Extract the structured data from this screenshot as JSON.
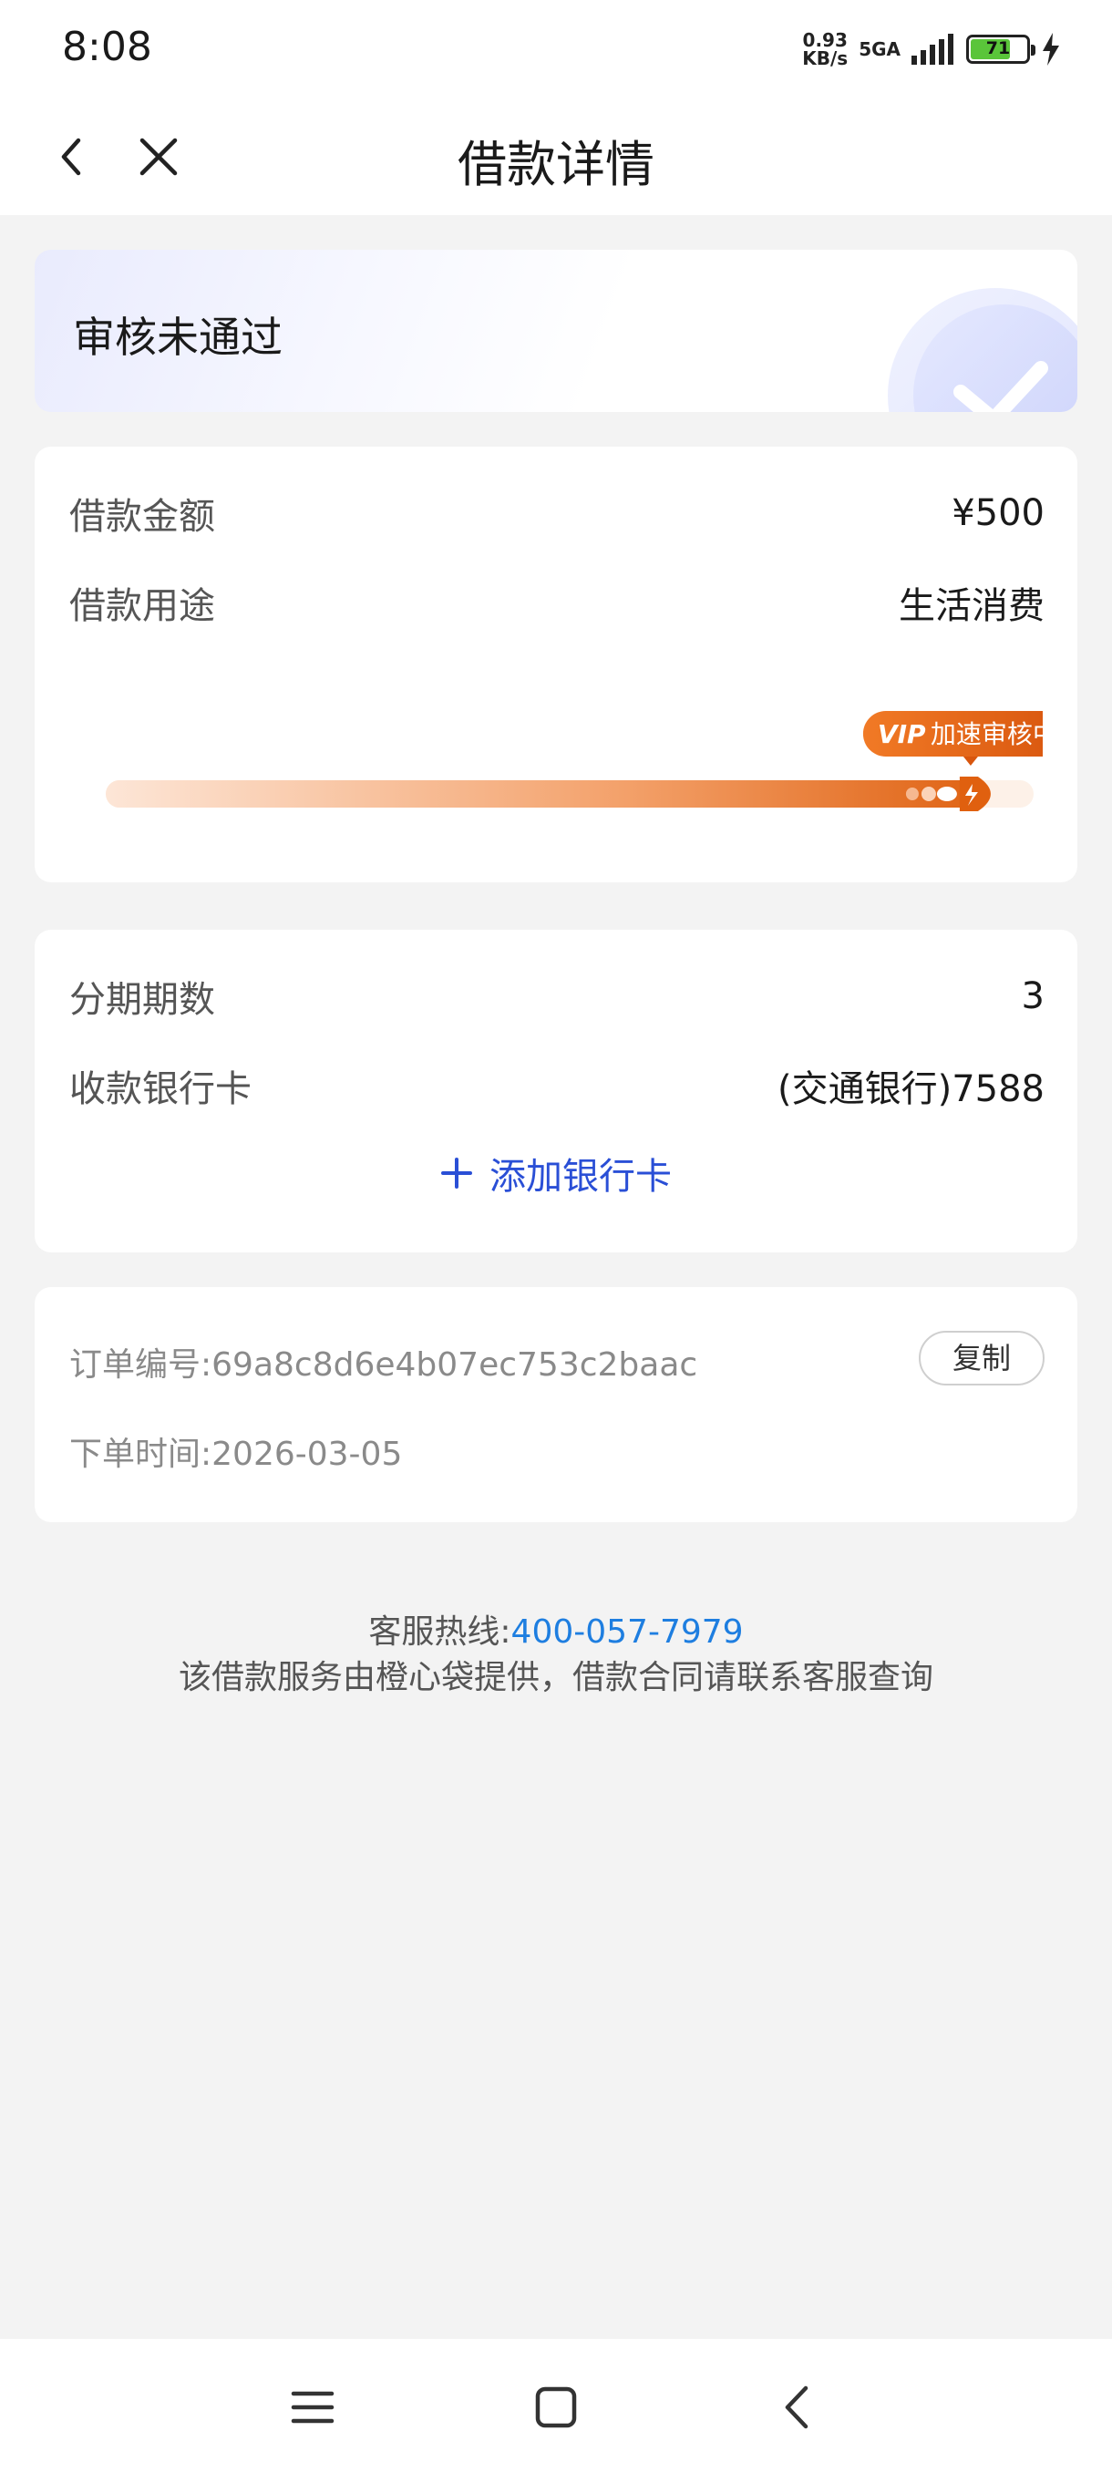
{
  "status_bar": {
    "time": "8:08",
    "net_speed_value": "0.93",
    "net_speed_unit": "KB/s",
    "network_type": "5GA",
    "battery_level": "71",
    "battery_fraction": 0.71,
    "battery_color": "#5ac53a",
    "charging_icon": "bolt-icon"
  },
  "nav": {
    "title": "借款详情",
    "back_icon": "chevron-left-icon",
    "close_icon": "close-icon"
  },
  "status_card": {
    "text": "审核未通过",
    "icon": "check-circle-icon"
  },
  "loan_info": {
    "amount_label": "借款金额",
    "amount_value": "¥500",
    "purpose_label": "借款用途",
    "purpose_value": "生活消费",
    "progress_badge_vip": "VIP",
    "progress_badge_text": "加速审核中",
    "progress_fraction": 0.94,
    "progress_color": "#e8701f"
  },
  "installment": {
    "periods_label": "分期期数",
    "periods_value": "3",
    "bank_label": "收款银行卡",
    "bank_value": "(交通银行)7588",
    "add_card_label": "添加银行卡",
    "add_icon": "plus-icon"
  },
  "order": {
    "number_label": "订单编号:",
    "number_value": "69a8c8d6e4b07ec753c2baac",
    "copy_label": "复制",
    "time_label": "下单时间:",
    "time_value": "2026-03-05"
  },
  "footer": {
    "hotline_label": "客服热线:",
    "hotline_number": "400-057-7979",
    "note": "该借款服务由橙心袋提供，借款合同请联系客服查询"
  },
  "colors": {
    "accent_blue": "#2a4fd6",
    "link_blue": "#1e7ee0",
    "progress_orange": "#e8701f",
    "background": "#f3f3f3"
  }
}
